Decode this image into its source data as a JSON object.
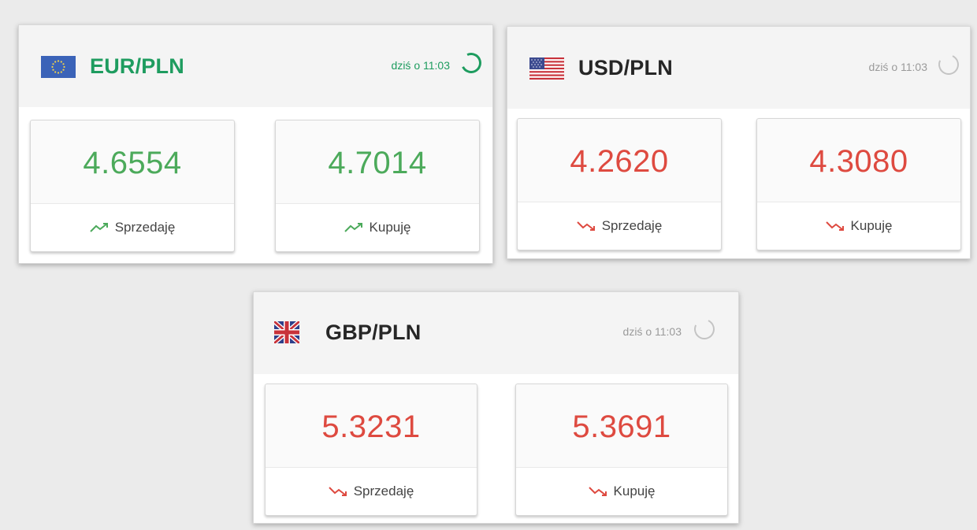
{
  "colors": {
    "up": "#4caa5b",
    "down": "#de4a40",
    "pair_active": "#1e9c5f",
    "pair_default": "#262626",
    "time_active": "#1e9c5f",
    "time_default": "#9a9a9a"
  },
  "cards": [
    {
      "pair": "EUR/PLN",
      "flag": "eu-flag-icon",
      "updated": "dziś o 11:03",
      "refresh_state": "refreshing",
      "sell": {
        "value": "4.6554",
        "label": "Sprzedaję",
        "trend": "up"
      },
      "buy": {
        "value": "4.7014",
        "label": "Kupuję",
        "trend": "up"
      }
    },
    {
      "pair": "USD/PLN",
      "flag": "us-flag-icon",
      "updated": "dziś o 11:03",
      "refresh_state": "idle",
      "sell": {
        "value": "4.2620",
        "label": "Sprzedaję",
        "trend": "down"
      },
      "buy": {
        "value": "4.3080",
        "label": "Kupuję",
        "trend": "down"
      }
    },
    {
      "pair": "GBP/PLN",
      "flag": "uk-flag-icon",
      "updated": "dziś o 11:03",
      "refresh_state": "idle",
      "sell": {
        "value": "5.3231",
        "label": "Sprzedaję",
        "trend": "down"
      },
      "buy": {
        "value": "5.3691",
        "label": "Kupuję",
        "trend": "down"
      }
    }
  ]
}
